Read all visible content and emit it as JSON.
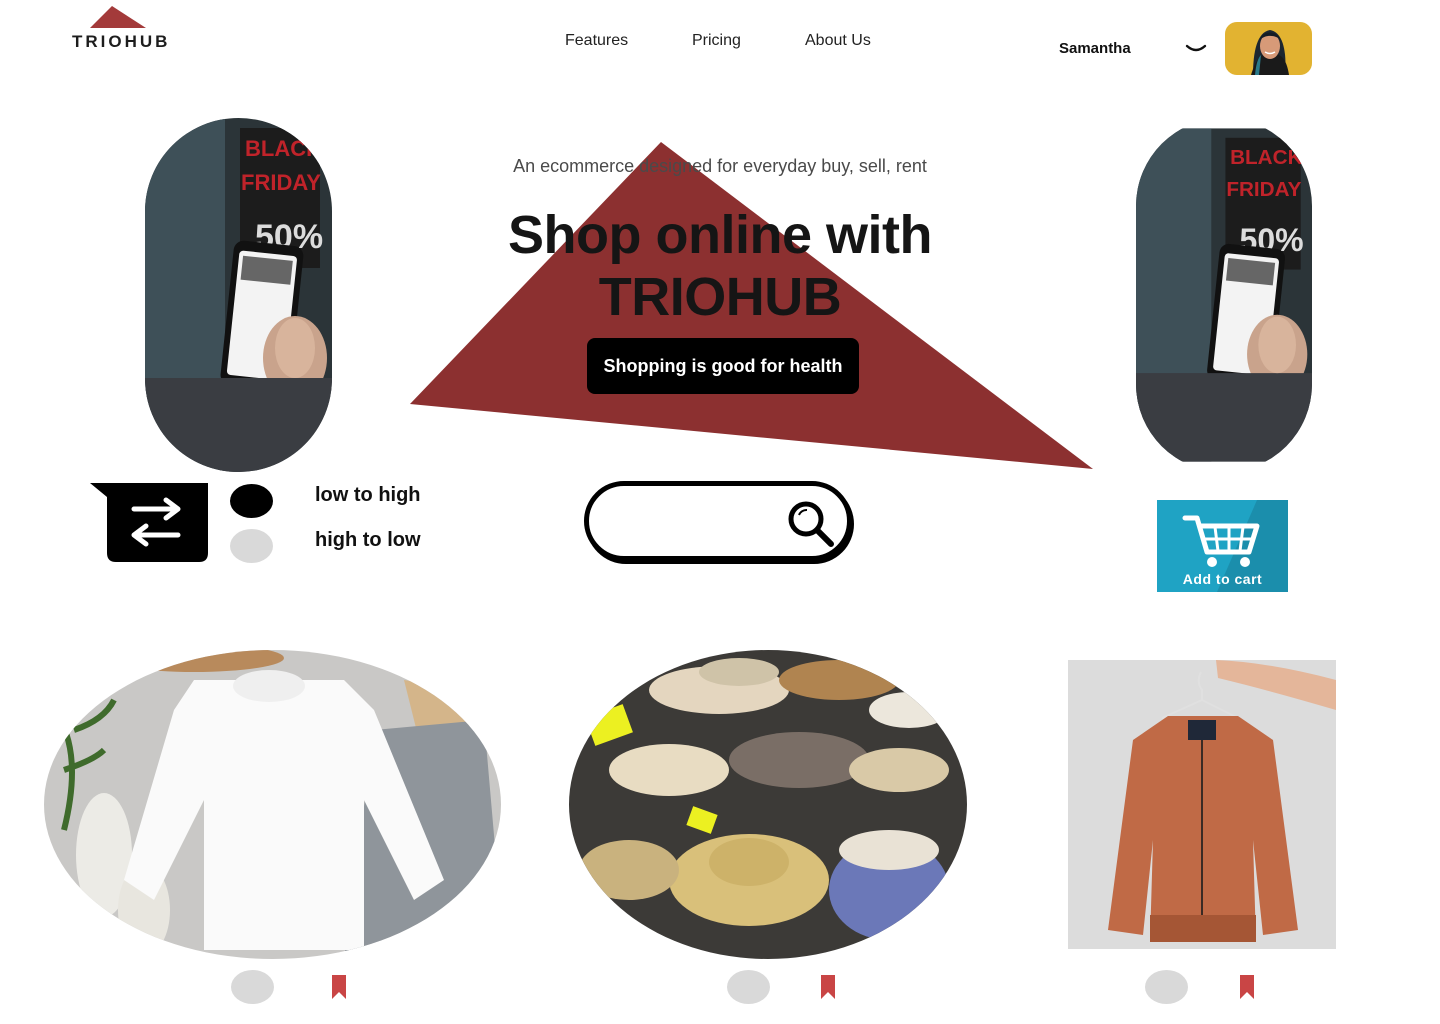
{
  "brand": {
    "name": "TRIOHUB",
    "accent": "#8c3030"
  },
  "nav": {
    "items": [
      "Features",
      "Pricing",
      "About Us"
    ]
  },
  "user": {
    "name": "Samantha"
  },
  "hero": {
    "subtitle": "An ecommerce designed for everyday buy, sell, rent",
    "headline_line1": "Shop online with",
    "headline_line2": "TRIOHUB",
    "cta": "Shopping is good for health"
  },
  "sort": {
    "options": [
      "low to high",
      "high to low"
    ],
    "selected": "low to high"
  },
  "search": {
    "value": "",
    "placeholder": ""
  },
  "cart": {
    "label": "Add to cart",
    "color": "#1fa3c4"
  },
  "products": [
    {
      "image": "white sweatshirt flat lay"
    },
    {
      "image": "straw hats display"
    },
    {
      "image": "orange bomber jacket on hanger"
    }
  ]
}
